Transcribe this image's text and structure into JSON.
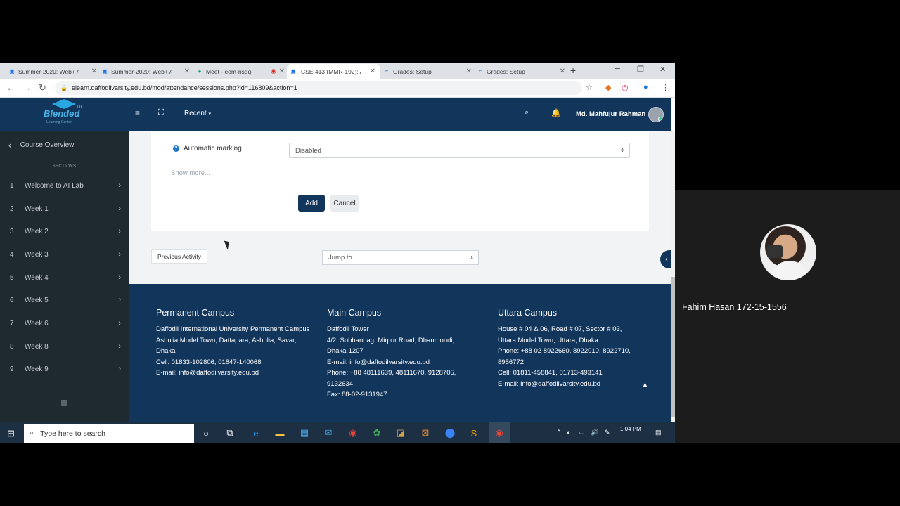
{
  "browser": {
    "tabs": [
      {
        "label": "Summer-2020: Web+ A",
        "icon": "moodle-icon",
        "active": false
      },
      {
        "label": "Summer-2020: Web+ A",
        "icon": "moodle-icon",
        "active": false
      },
      {
        "label": "Meet - eem-nsdq-",
        "icon": "meet-icon",
        "active": false
      },
      {
        "label": "CSE 413 (MMR-192): A",
        "icon": "moodle-icon",
        "active": true
      },
      {
        "label": "Grades: Setup",
        "icon": "moodle-icon",
        "active": false
      },
      {
        "label": "Grades: Setup",
        "icon": "moodle-icon",
        "active": false
      }
    ],
    "url": "elearn.daffodilvarsity.edu.bd/mod/attendance/sessions.php?id=116809&action=1"
  },
  "navbar": {
    "logo_text": "Blended",
    "logo_badge": "DIU",
    "logo_sub": "Learning Center",
    "recent_label": "Recent",
    "user_name": "Md. Mahfujur Rahman"
  },
  "sidebar": {
    "overview_label": "Course Overview",
    "sections_label": "SECTIONS",
    "items": [
      {
        "num": "1",
        "label": "Welcome to AI Lab"
      },
      {
        "num": "2",
        "label": "Week 1"
      },
      {
        "num": "3",
        "label": "Week 2"
      },
      {
        "num": "4",
        "label": "Week 3"
      },
      {
        "num": "5",
        "label": "Week 4"
      },
      {
        "num": "6",
        "label": "Week 5"
      },
      {
        "num": "7",
        "label": "Week 6"
      },
      {
        "num": "8",
        "label": "Week 8"
      },
      {
        "num": "9",
        "label": "Week 9"
      }
    ]
  },
  "form": {
    "automatic_marking_label": "Automatic marking",
    "automatic_marking_value": "Disabled",
    "show_more": "Show more...",
    "add_label": "Add",
    "cancel_label": "Cancel",
    "previous_activity": "Previous Activity",
    "jump_to": "Jump to..."
  },
  "footer": {
    "columns": [
      {
        "title": "Permanent Campus",
        "lines": [
          "Daffodil International University Permanent Campus",
          "Ashulia Model Town, Dattapara, Ashulia, Savar, Dhaka",
          "Cell: 01833-102806, 01847-140068",
          "E-mail: info@daffodilvarsity.edu.bd"
        ]
      },
      {
        "title": "Main Campus",
        "lines": [
          "Daffodil Tower",
          "4/2, Sobhanbag, Mirpur Road, Dhanmondi, Dhaka-1207",
          "E-mail: info@daffodilvarsity.edu.bd",
          "Phone: +88 48111639, 48111670, 9128705, 9132634",
          "Fax: 88-02-9131947"
        ]
      },
      {
        "title": "Uttara Campus",
        "lines": [
          "House # 04 & 06, Road # 07, Sector # 03, Uttara Model Town, Uttara, Dhaka",
          "Phone: +88 02 8922660, 8922010, 8922710, 8956772",
          "Cell:  01811-458841, 01713-493141",
          "E-mail: info@daffodilvarsity.edu.bd"
        ]
      }
    ]
  },
  "taskbar": {
    "search_placeholder": "Type here to search",
    "time": "1:04 PM"
  },
  "participant": {
    "name": "Fahim Hasan 172-15-1556"
  },
  "colors": {
    "brand_navy": "#12355b",
    "sidebar_bg": "#1f2930",
    "accent_blue": "#1d73c5"
  }
}
